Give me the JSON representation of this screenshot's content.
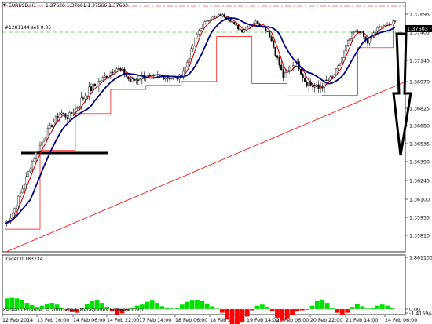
{
  "header": {
    "symbol": "EURUSD,H1",
    "ohlc": "1.37620 1.37661 1.37566 1.37603",
    "order_label": "#1281144 sell 0.05"
  },
  "price_axis": {
    "labels": [
      "1.37695",
      "1.37405",
      "1.37145",
      "1.36970",
      "1.36825",
      "1.36680",
      "1.36535",
      "1.36390",
      "1.36245",
      "1.36100",
      "1.35955",
      "1.35810"
    ],
    "current_price": "1.37603"
  },
  "indicator": {
    "label": "Trader 0.183734",
    "axis_labels": [
      "1.861133",
      "0.00",
      "-1.415944"
    ]
  },
  "time_axis": {
    "labels": [
      "12 Feb 2014",
      "13 Feb 16:00",
      "14 Feb 06:00",
      "14 Feb 22:00",
      "17 Feb 14:00",
      "18 Feb 06:00",
      "18 Feb 22:00",
      "19 Feb 14:00",
      "20 Feb 06:00",
      "20 Feb 22:00",
      "21 Feb 14:00",
      "24 Feb 06:00"
    ]
  },
  "copyright": "Panteon Finance, © 2001-2014, MetaQuotes Software Corp.",
  "colors": {
    "background": "#ffffff",
    "candles": "#000000",
    "moving_average": "#000080",
    "channel": "#ff0000",
    "trendline": "#ff0000",
    "order_line": "#00c000",
    "hist_positive": "#00e000",
    "hist_negative": "#ff0000",
    "grid": "#c0c0c0"
  },
  "chart_data": [
    {
      "type": "candlestick",
      "symbol": "EURUSD",
      "timeframe": "H1",
      "y_ticks": [
        1.37695,
        1.37405,
        1.37145,
        1.3697,
        1.36825,
        1.3668,
        1.36535,
        1.3639,
        1.36245,
        1.361,
        1.35955,
        1.3581
      ],
      "current_price": 1.37603,
      "closes": [
        1.359,
        1.3597,
        1.3611,
        1.3625,
        1.364,
        1.3651,
        1.3662,
        1.3671,
        1.3679,
        1.3675,
        1.3681,
        1.3687,
        1.3692,
        1.3695,
        1.3699,
        1.3704,
        1.3708,
        1.3705,
        1.3697,
        1.3699,
        1.3702,
        1.37,
        1.3702,
        1.3701,
        1.37,
        1.37,
        1.371,
        1.3728,
        1.3746,
        1.376,
        1.3765,
        1.3768,
        1.3764,
        1.3752,
        1.3742,
        1.3752,
        1.3757,
        1.375,
        1.3738,
        1.3718,
        1.37,
        1.371,
        1.3712,
        1.3698,
        1.3695,
        1.3693,
        1.3697,
        1.37,
        1.371,
        1.3728,
        1.374,
        1.3742,
        1.373,
        1.3741,
        1.3751,
        1.3752,
        1.376
      ]
    },
    {
      "type": "bar",
      "name": "Trader",
      "value": 0.183734,
      "ylim": [
        -1.415944,
        1.861133
      ],
      "values": [
        0.95,
        1.0,
        0.95,
        0.8,
        0.55,
        0.35,
        0.2,
        0.3,
        0.45,
        0.55,
        0.4,
        0.15,
        -0.1,
        -0.25,
        -0.3,
        0.1,
        0.45,
        0.7,
        0.8,
        0.55,
        0.2,
        -0.2,
        -0.45,
        -0.35,
        -0.1,
        0.15,
        0.3,
        0.4,
        0.65,
        0.75,
        0.55,
        0.25,
        0.1,
        0.05,
        0.1,
        0.4,
        0.65,
        0.75,
        0.8,
        0.7,
        0.5,
        0.25,
        0.05,
        -0.3,
        -0.85,
        -1.25,
        -1.35,
        -1.1,
        -0.6,
        -0.1,
        0.3,
        0.4,
        0.2,
        -0.2,
        -0.7,
        -0.95,
        -0.75,
        -0.45,
        -0.2,
        -0.1,
        -0.05,
        0.3,
        0.7,
        0.85,
        0.55,
        0.1,
        -0.3,
        -0.5,
        -0.3,
        0.2,
        0.45,
        0.25,
        0.05,
        0.1,
        0.3,
        0.4,
        0.3,
        0.15
      ]
    }
  ]
}
